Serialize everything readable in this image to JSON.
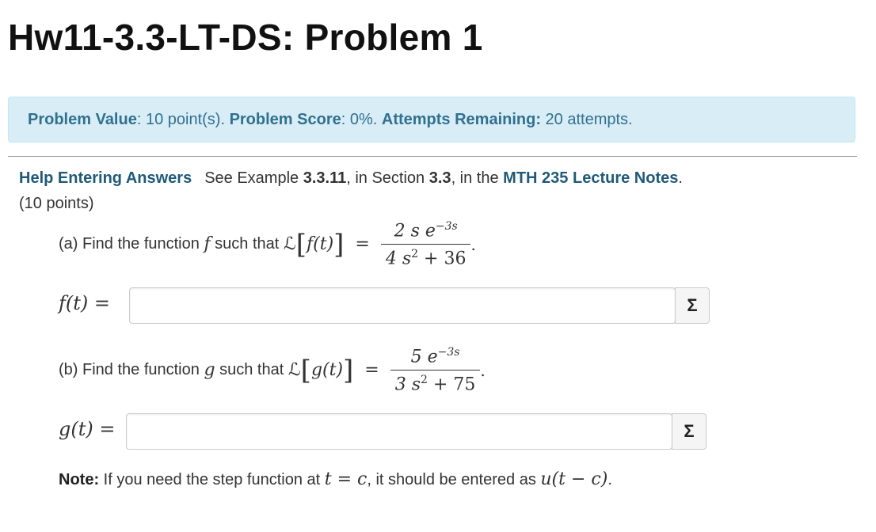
{
  "title": "Hw11-3.3-LT-DS: Problem 1",
  "info": {
    "value_label": "Problem Value",
    "value_text": ": 10 point(s). ",
    "score_label": "Problem Score",
    "score_text": ": 0%. ",
    "attempts_label": "Attempts Remaining:",
    "attempts_text": " 20 attempts."
  },
  "help": {
    "link": "Help Entering Answers",
    "see": "See Example ",
    "example": "3.3.11",
    "mid": ", in Section ",
    "section": "3.3",
    "mid2": ", in the ",
    "notes": "MTH 235 Lecture Notes",
    "end": "."
  },
  "points": "(10 points)",
  "part_a": {
    "prefix": "(a) Find the function ",
    "var": "f",
    "middle": " such that ",
    "laplace": "ℒ",
    "arg": "f(t)",
    "numerator_coef": "2 s e",
    "numerator_exp": "−3s",
    "denominator": "4 s",
    "denominator_exp": "2",
    "denominator_tail": " + 36",
    "period": "."
  },
  "answer_a": {
    "label": "f(t) =",
    "value": "",
    "placeholder": ""
  },
  "part_b": {
    "prefix": "(b) Find the function ",
    "var": "g",
    "middle": " such that ",
    "laplace": "ℒ",
    "arg": "g(t)",
    "numerator_coef": "5 e",
    "numerator_exp": "−3s",
    "denominator": "3 s",
    "denominator_exp": "2",
    "denominator_tail": " + 75",
    "period": "."
  },
  "answer_b": {
    "label": "g(t) =",
    "value": "",
    "placeholder": ""
  },
  "equation_editor_icon": "sigma-icon",
  "equation_editor_symbol": "Σ",
  "note": {
    "label": "Note:",
    "text1": " If you need the step function at ",
    "math1": "t = c",
    "text2": ", it should be entered as ",
    "math2": "u(t − c)",
    "text3": "."
  },
  "colors": {
    "info_bg": "#d9edf7",
    "info_text": "#31708f",
    "link": "#1f5a78"
  }
}
